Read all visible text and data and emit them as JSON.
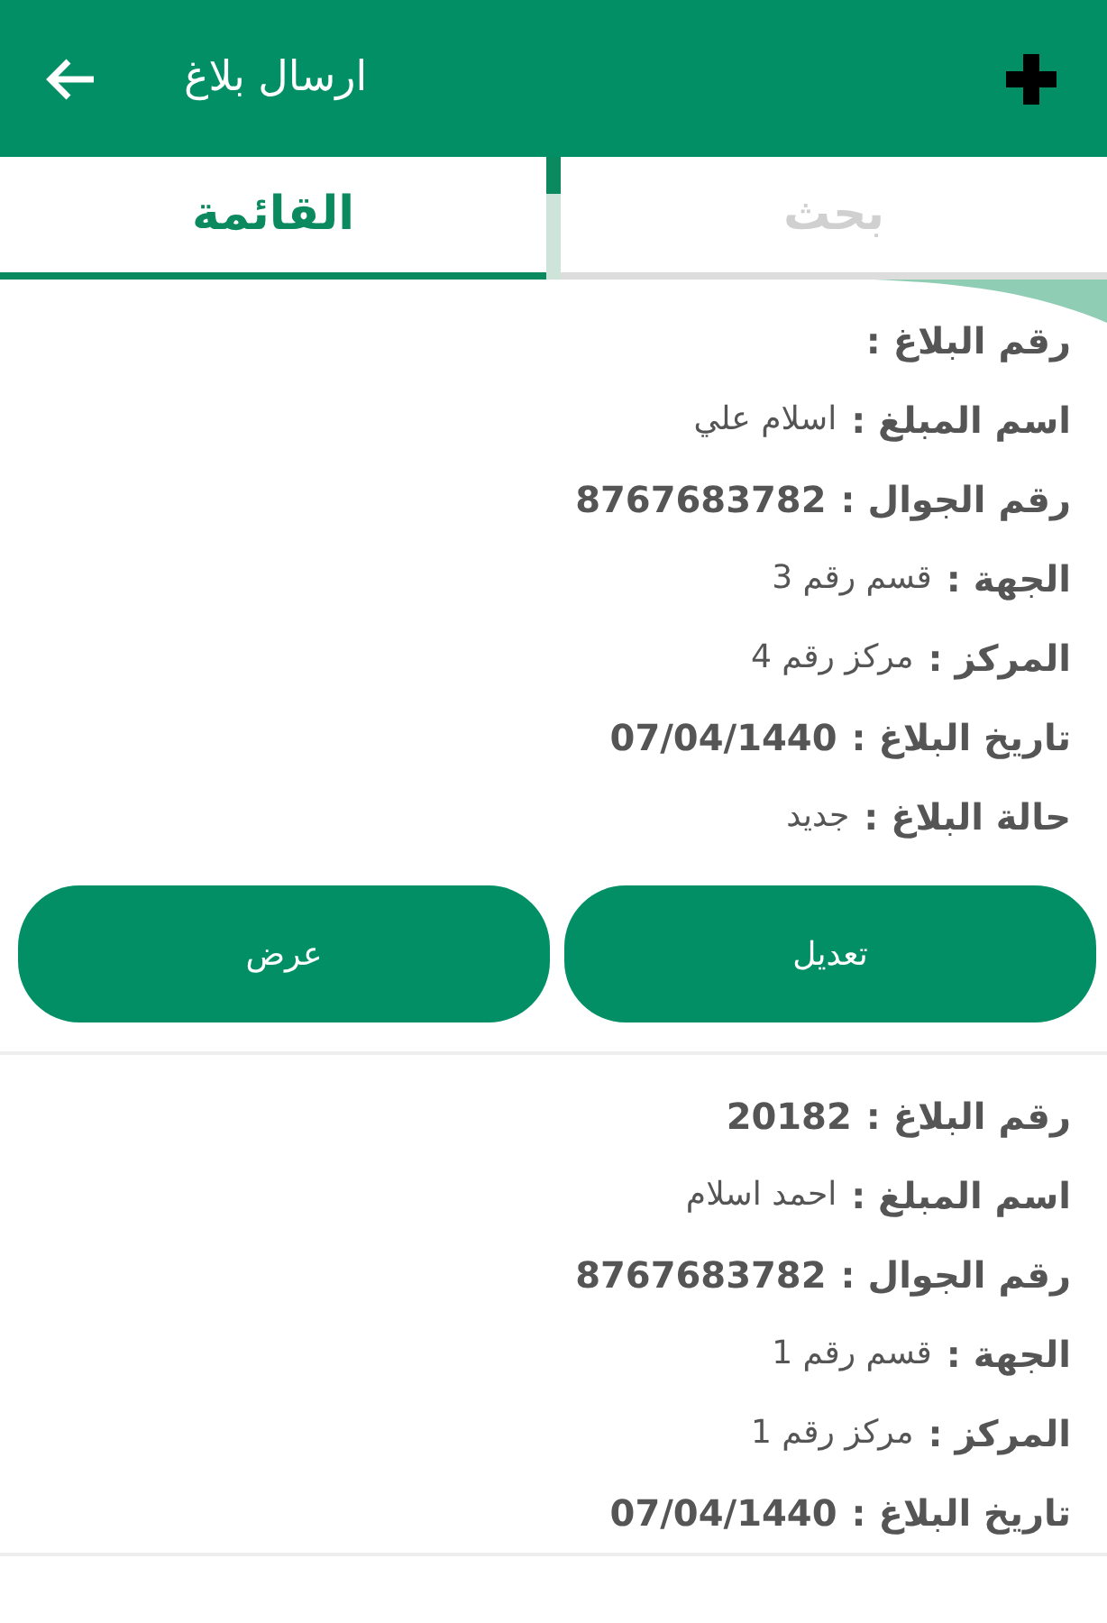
{
  "app_bar": {
    "title": "ارسال بلاغ"
  },
  "tabs": [
    {
      "label": "بحث",
      "selected": false
    },
    {
      "label": "القائمة",
      "selected": true
    }
  ],
  "reports": [
    {
      "fields": [
        {
          "label": "رقم البلاغ :"
        },
        {
          "label": "اسم المبلغ :",
          "value": "اسلام علي",
          "kind": "text"
        },
        {
          "label": "رقم الجوال :",
          "value": "8767683782",
          "kind": "number"
        },
        {
          "label": "الجهة :",
          "value": "قسم رقم 3",
          "kind": "text"
        },
        {
          "label": "المركز :",
          "value": "مركز رقم 4",
          "kind": "text"
        },
        {
          "label": "تاريخ البلاغ :",
          "value": "07/04/1440",
          "kind": "number"
        },
        {
          "label": "حالة البلاغ :",
          "value": "جديد",
          "kind": "text"
        }
      ],
      "buttons": [
        "تعديل",
        "عرض"
      ]
    },
    {
      "fields": [
        {
          "label": "رقم البلاغ :",
          "value": "20182",
          "kind": "number"
        },
        {
          "label": "اسم المبلغ :",
          "value": "احمد اسلام",
          "kind": "text"
        },
        {
          "label": "رقم الجوال :",
          "value": "8767683782",
          "kind": "number"
        },
        {
          "label": "الجهة :",
          "value": "قسم رقم 1",
          "kind": "text"
        },
        {
          "label": "المركز :",
          "value": "مركز رقم 1",
          "kind": "text"
        },
        {
          "label": "تاريخ البلاغ :",
          "value": "07/04/1440",
          "kind": "number"
        }
      ]
    }
  ]
}
